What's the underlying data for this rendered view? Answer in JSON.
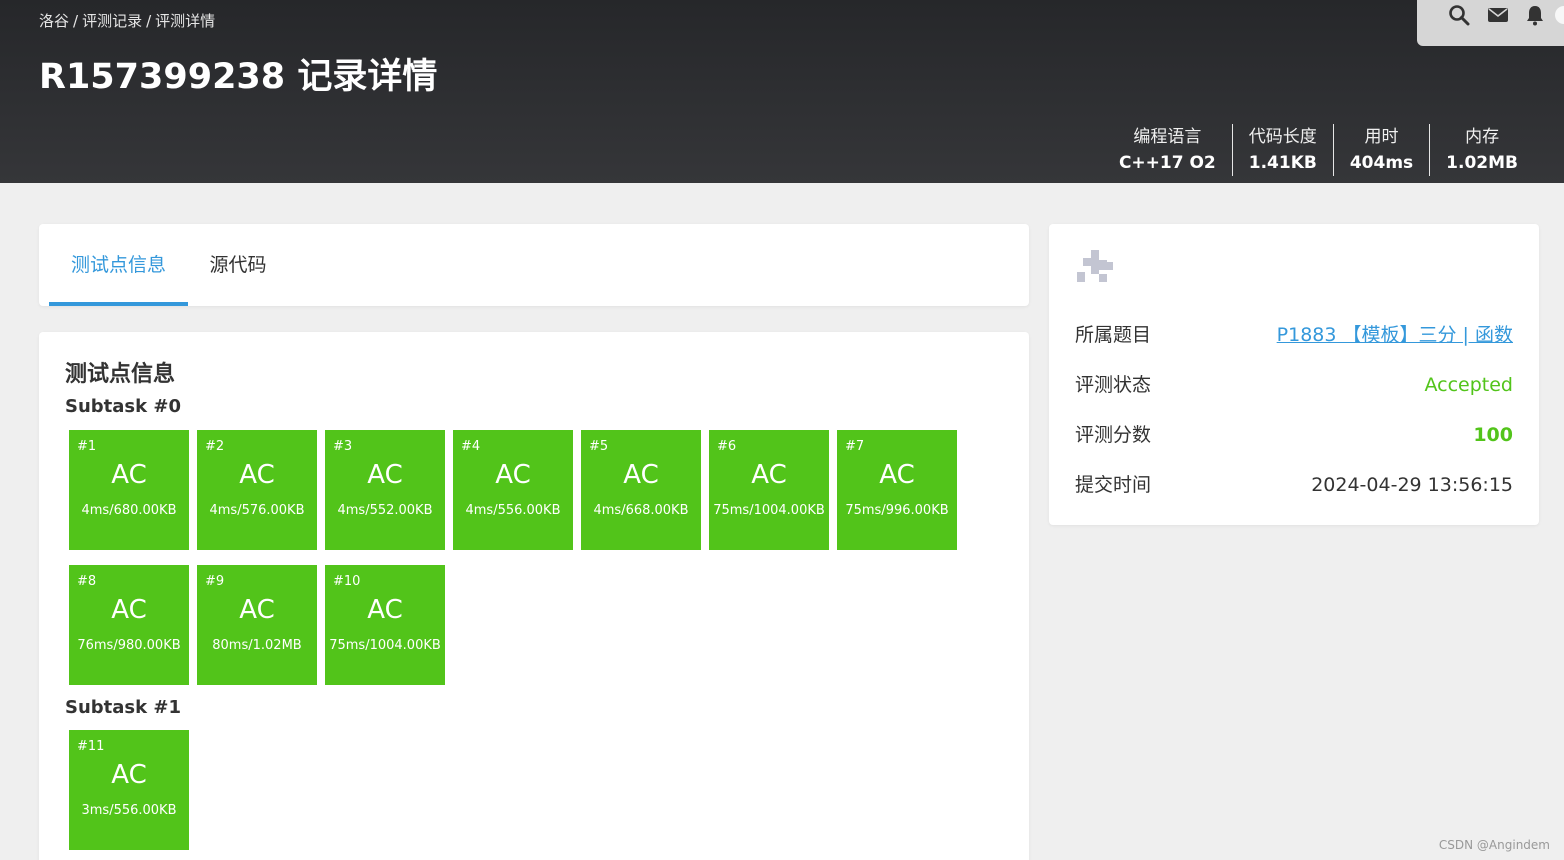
{
  "breadcrumb": [
    "洛谷",
    "评测记录",
    "评测详情"
  ],
  "page_title": "R157399238 记录详情",
  "top_icons": [
    "search-icon",
    "mail-icon",
    "bell-icon"
  ],
  "stats": [
    {
      "label": "编程语言",
      "value": "C++17 O2"
    },
    {
      "label": "代码长度",
      "value": "1.41KB"
    },
    {
      "label": "用时",
      "value": "404ms"
    },
    {
      "label": "内存",
      "value": "1.02MB"
    }
  ],
  "tabs": [
    {
      "label": "测试点信息",
      "active": true
    },
    {
      "label": "源代码",
      "active": false
    }
  ],
  "tests": {
    "title": "测试点信息",
    "subtasks": [
      {
        "name": "Subtask #0",
        "cases": [
          {
            "id": "#1",
            "status": "AC",
            "detail": "4ms/680.00KB"
          },
          {
            "id": "#2",
            "status": "AC",
            "detail": "4ms/576.00KB"
          },
          {
            "id": "#3",
            "status": "AC",
            "detail": "4ms/552.00KB"
          },
          {
            "id": "#4",
            "status": "AC",
            "detail": "4ms/556.00KB"
          },
          {
            "id": "#5",
            "status": "AC",
            "detail": "4ms/668.00KB"
          },
          {
            "id": "#6",
            "status": "AC",
            "detail": "75ms/1004.00KB"
          },
          {
            "id": "#7",
            "status": "AC",
            "detail": "75ms/996.00KB"
          },
          {
            "id": "#8",
            "status": "AC",
            "detail": "76ms/980.00KB"
          },
          {
            "id": "#9",
            "status": "AC",
            "detail": "80ms/1.02MB"
          },
          {
            "id": "#10",
            "status": "AC",
            "detail": "75ms/1004.00KB"
          }
        ]
      },
      {
        "name": "Subtask #1",
        "cases": [
          {
            "id": "#11",
            "status": "AC",
            "detail": "3ms/556.00KB"
          }
        ]
      }
    ]
  },
  "info": {
    "problem_label": "所属题目",
    "problem_value": "P1883 【模板】三分 | 函数",
    "status_label": "评测状态",
    "status_value": "Accepted",
    "score_label": "评测分数",
    "score_value": "100",
    "time_label": "提交时间",
    "time_value": "2024-04-29 13:56:15"
  },
  "colors": {
    "accent": "#3498db",
    "ac_green": "#52c41a",
    "header_bg": "#2b2c2f"
  },
  "watermark": "CSDN @Angindem"
}
